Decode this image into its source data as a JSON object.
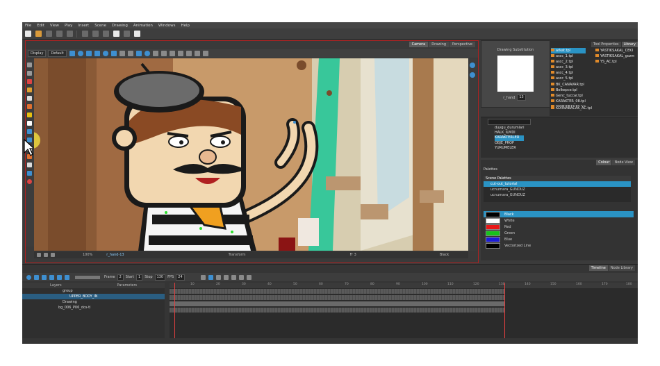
{
  "menu": [
    "File",
    "Edit",
    "View",
    "Play",
    "Insert",
    "Scene",
    "Drawing",
    "Animation",
    "Windows",
    "Help"
  ],
  "camera": {
    "tabs": [
      "Camera",
      "Drawing",
      "Perspective"
    ],
    "display_select": "Display",
    "default_select": "Default",
    "zoom": "100%",
    "node": "r_hand-13",
    "status_center": "Transform",
    "status_frame": "Fr 3",
    "status_color": "Black"
  },
  "drawing_substitution": {
    "title": "Drawing Substitution",
    "name": "r_hand",
    "value": "13"
  },
  "library": {
    "tabs": [
      "Tool Properties",
      "Library"
    ],
    "files_col1": [
      "arkat.tpl",
      "ascc_1.tpl",
      "ascc_2.tpl",
      "ascc_3.tpl",
      "ascc_4.tpl",
      "ascc_5.tpl",
      "BK_CANAVAR.tpl",
      "Bolkepce.tpl",
      "Genc_tuccar.tpl",
      "KARAKTER_08.tpl",
      "KORNABACAK.tpl",
      "KORNABACAK_AC.tpl",
      "PATRON.tpl",
      "PATRON_YENI.tpl",
      "UCNUMARA.tpl",
      "UCNUMARA_AC.tpl",
      "YASTIKSAKAL.tpl"
    ],
    "files_col2": [
      "YASTIKSAKAL_CEKI",
      "YASTIKSAKAL_gozm",
      "YS_AC.tpl"
    ]
  },
  "tree": {
    "items": [
      "duygu_durumlari",
      "HALK_ILMDI",
      "KARAKTERLER",
      "OBJE_PROP",
      "YURUMELER"
    ],
    "selected": "KARAKTERLER"
  },
  "colour": {
    "tabs": [
      "Colour",
      "Node View"
    ],
    "palettes_label": "Palettes",
    "scene_palettes": "Scene Palettes",
    "palette_items": [
      "cut-out_tutorial",
      "ucnumara_GUNDUZ",
      "ucnumara_GUNDUZ"
    ],
    "swatches": [
      {
        "name": "Black",
        "color": "#000000"
      },
      {
        "name": "White",
        "color": "#ffffff"
      },
      {
        "name": "Red",
        "color": "#e81616"
      },
      {
        "name": "Green",
        "color": "#16c21c"
      },
      {
        "name": "Blue",
        "color": "#1c1cd8"
      },
      {
        "name": "Vectorized Line",
        "color": "#000000"
      }
    ]
  },
  "timeline": {
    "tabs": [
      "Timeline",
      "Node Library"
    ],
    "frame_label": "Frame",
    "frame_value": "2",
    "start_label": "Start",
    "start_value": "1",
    "stop_label": "Stop",
    "stop_value": "130",
    "fps_label": "FPS",
    "fps_value": "24",
    "layers_header": "Layers",
    "params_header": "Parameters",
    "layers": [
      "group",
      "UPPER_BODY_IN",
      "Drawing",
      "bg_006_P06_dcs-tl"
    ],
    "ruler": [
      "10",
      "20",
      "30",
      "40",
      "50",
      "60",
      "70",
      "80",
      "90",
      "100",
      "110",
      "120",
      "130",
      "140",
      "150",
      "160",
      "170",
      "180"
    ]
  }
}
